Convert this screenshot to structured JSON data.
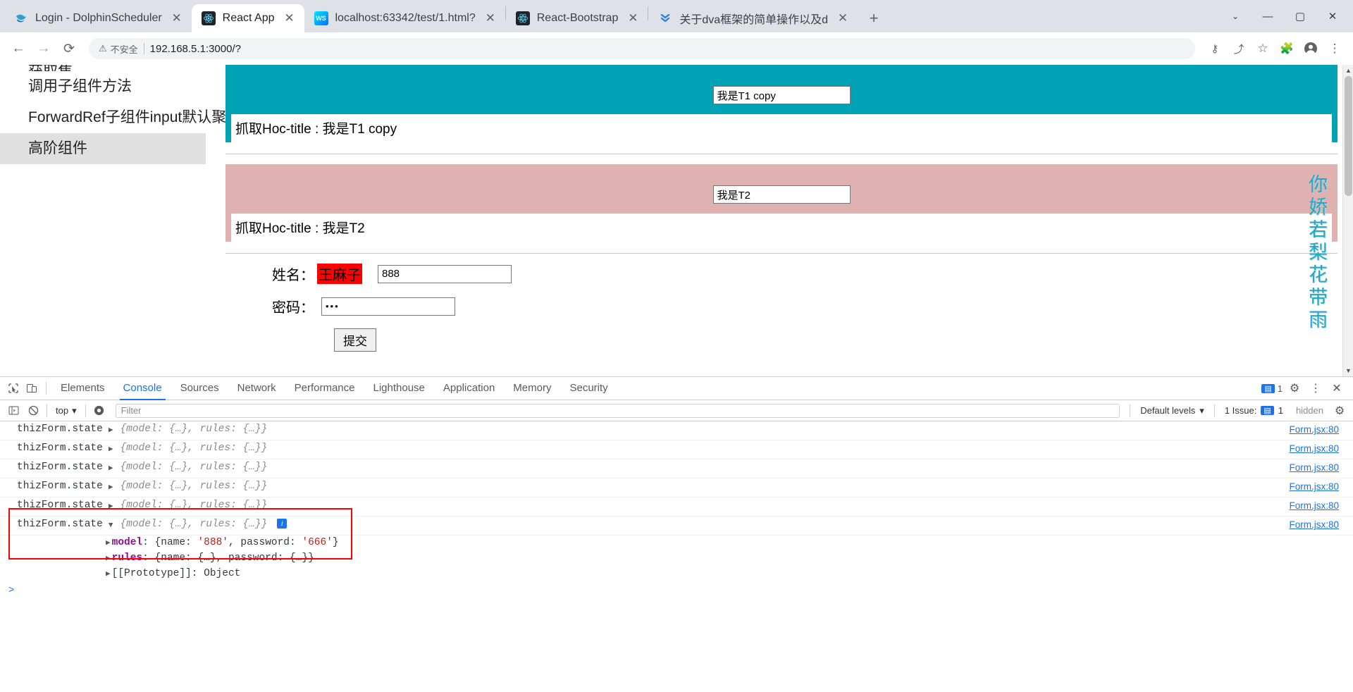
{
  "browser": {
    "tabs": [
      {
        "title": "Login - DolphinScheduler",
        "favicon": "dolphin-icon",
        "active": false
      },
      {
        "title": "React App",
        "favicon": "react-icon",
        "active": true
      },
      {
        "title": "localhost:63342/test/1.html?",
        "favicon": "webstorm-icon",
        "active": false
      },
      {
        "title": "React-Bootstrap",
        "favicon": "react-bootstrap-icon",
        "active": false
      },
      {
        "title": "关于dva框架的简单操作以及d",
        "favicon": "csdn-icon",
        "active": false
      }
    ],
    "new_tab_label": "+",
    "tab_search_label": "⌄",
    "window_minimize": "—",
    "window_maximize": "▢",
    "window_close": "✕",
    "close_label": "✕",
    "toolbar": {
      "back_label": "←",
      "forward_label": "→",
      "reload_label": "⟳",
      "security_warning": "不安全",
      "warning_icon": "warning-triangle-icon",
      "url": "192.168.5.1:3000/?",
      "key_icon": "key-icon",
      "share_icon": "share-icon",
      "star_icon": "star-icon",
      "extensions_icon": "puzzle-icon",
      "profile_icon": "profile-icon",
      "menu_icon": "kebab-menu-icon"
    }
  },
  "page": {
    "sidenav": {
      "clipped_item": "获取焦",
      "items": [
        {
          "label": "调用子组件方法",
          "selected": false
        },
        {
          "label": "ForwardRef子组件input默认聚焦",
          "selected": false
        },
        {
          "label": "高阶组件",
          "selected": true
        }
      ]
    },
    "panels": [
      {
        "color": "#00a2b5",
        "input_value": "我是T1 copy",
        "title_text": "抓取Hoc-title : 我是T1 copy"
      },
      {
        "color": "#dfb1b1",
        "input_value": "我是T2",
        "title_text": "抓取Hoc-title : 我是T2"
      }
    ],
    "form": {
      "name_label": "姓名：",
      "name_chip": "王麻子",
      "name_value": "888",
      "password_label": "密码：",
      "password_value": "•••",
      "submit_label": "提交"
    },
    "poem": "你娇若梨花带雨"
  },
  "devtools": {
    "inspect_icon": "inspect-cursor-icon",
    "device_icon": "device-toolbar-icon",
    "tabs": [
      {
        "label": "Elements",
        "active": false
      },
      {
        "label": "Console",
        "active": true
      },
      {
        "label": "Sources",
        "active": false
      },
      {
        "label": "Network",
        "active": false
      },
      {
        "label": "Performance",
        "active": false
      },
      {
        "label": "Lighthouse",
        "active": false
      },
      {
        "label": "Application",
        "active": false
      },
      {
        "label": "Memory",
        "active": false
      },
      {
        "label": "Security",
        "active": false
      }
    ],
    "tabbar_right": {
      "issue_count": "1",
      "issue_icon": "issue-message-icon",
      "settings_icon": "gear-icon",
      "more_icon": "kebab-menu-icon",
      "close_icon": "close-icon"
    },
    "filterbar": {
      "run_icon": "console-sidebar-icon",
      "clear_icon": "clear-console-icon",
      "context": "top",
      "context_caret": "▾",
      "eye_icon": "live-expression-icon",
      "filter_placeholder": "Filter",
      "levels_label": "Default levels",
      "levels_caret": "▾",
      "issues_label": "1 Issue:",
      "issues_count": "1",
      "hidden_label": "hidden",
      "settings_icon": "gear-icon"
    },
    "console": {
      "collapsed_rows": [
        {
          "label": "thizForm.state",
          "triangle": "▶",
          "preview": "{model: {…}, rules: {…}}",
          "source": "Form.jsx:80"
        },
        {
          "label": "thizForm.state",
          "triangle": "▶",
          "preview": "{model: {…}, rules: {…}}",
          "source": "Form.jsx:80"
        },
        {
          "label": "thizForm.state",
          "triangle": "▶",
          "preview": "{model: {…}, rules: {…}}",
          "source": "Form.jsx:80"
        },
        {
          "label": "thizForm.state",
          "triangle": "▶",
          "preview": "{model: {…}, rules: {…}}",
          "source": "Form.jsx:80"
        },
        {
          "label": "thizForm.state",
          "triangle": "▶",
          "preview": "{model: {…}, rules: {…}}",
          "source": "Form.jsx:80"
        }
      ],
      "expanded_row": {
        "label": "thizForm.state",
        "triangle": "▼",
        "preview": "{model: {…}, rules: {…}}",
        "source": "Form.jsx:80",
        "info_badge": "i",
        "properties": [
          {
            "triangle": "▶",
            "key": "model",
            "value_prefix": "{name: ",
            "value_1": "'888'",
            "value_mid": ", password: ",
            "value_2": "'666'",
            "value_suffix": "}"
          },
          {
            "triangle": "▶",
            "key": "rules",
            "value_plain": "{name: {…}, password: {…}}"
          },
          {
            "triangle": "▶",
            "key": "[[Prototype]]",
            "value_plain": "Object"
          }
        ]
      },
      "prompt": ">",
      "highlight_color": "#ff0000"
    }
  }
}
